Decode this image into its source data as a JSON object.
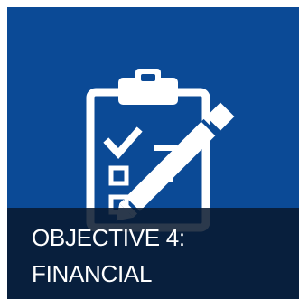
{
  "tile": {
    "caption_line1": "OBJECTIVE 4:",
    "caption_line2": "FINANCIAL",
    "icon": "clipboard-checklist-pencil-icon",
    "colors": {
      "background": "#0b4a96",
      "caption_overlay": "#08182e",
      "foreground": "#ffffff"
    }
  }
}
